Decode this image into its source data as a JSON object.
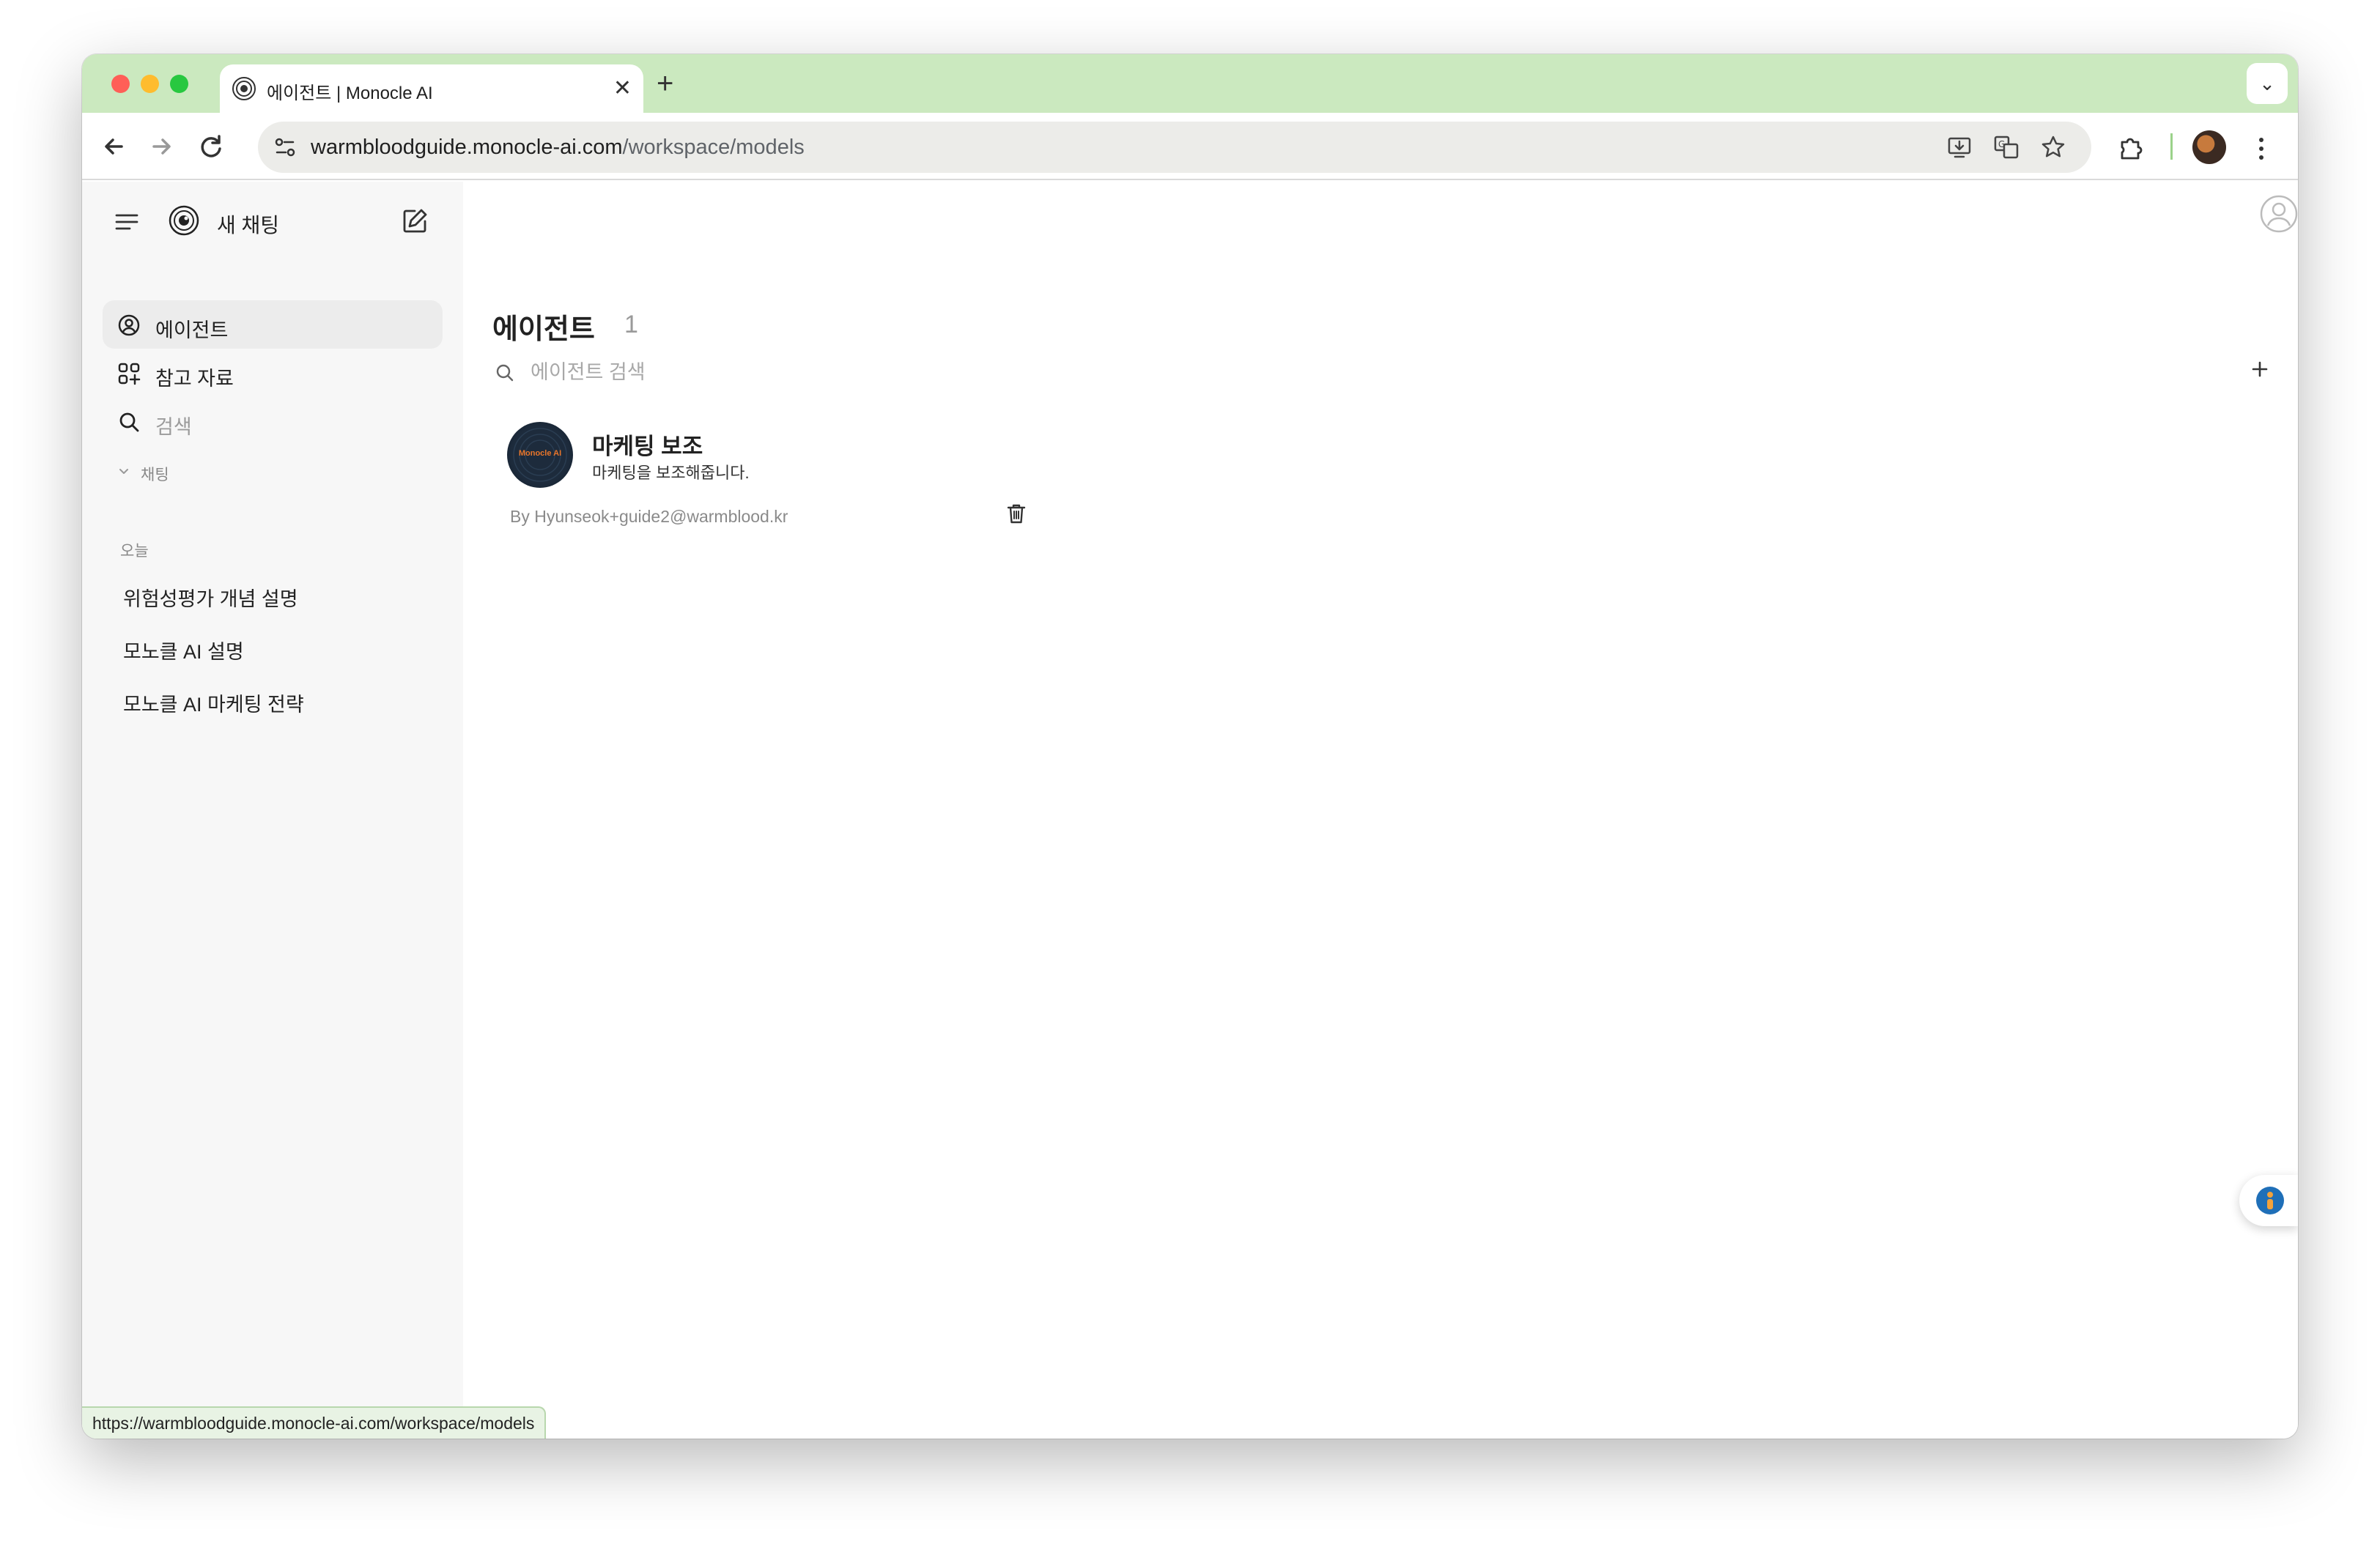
{
  "browser": {
    "tab_title": "에이전트 | Monocle AI",
    "tab_close": "✕",
    "new_tab": "+",
    "tab_menu": "⌄",
    "url_host": "warmbloodguide.monocle-ai.com",
    "url_path": "/workspace/models",
    "status_url": "https://warmbloodguide.monocle-ai.com/workspace/models"
  },
  "sidebar": {
    "new_chat": "새 채팅",
    "items": [
      {
        "label": "에이전트",
        "icon": "user-circle-icon",
        "active": true
      },
      {
        "label": "참고 자료",
        "icon": "grid-plus-icon",
        "active": false
      },
      {
        "label": "검색",
        "icon": "search-icon",
        "active": false
      }
    ],
    "chats_toggle": "채팅",
    "today_label": "오늘",
    "chats": [
      "위험성평가 개념 설명",
      "모노클 AI 설명",
      "모노클 AI 마케팅 전략"
    ]
  },
  "main": {
    "title": "에이전트",
    "count": "1",
    "search_placeholder": "에이전트 검색",
    "agents": [
      {
        "avatar_text": "Monocle AI",
        "name": "마케팅 보조",
        "description": "마케팅을 보조해줍니다.",
        "author": "By Hyunseok+guide2@warmblood.kr"
      }
    ]
  },
  "colors": {
    "tabstrip": "#cbe9bf",
    "sidebar_bg": "#f7f7f7",
    "active_item": "#ececec",
    "avatar_accent": "#e8752a"
  }
}
